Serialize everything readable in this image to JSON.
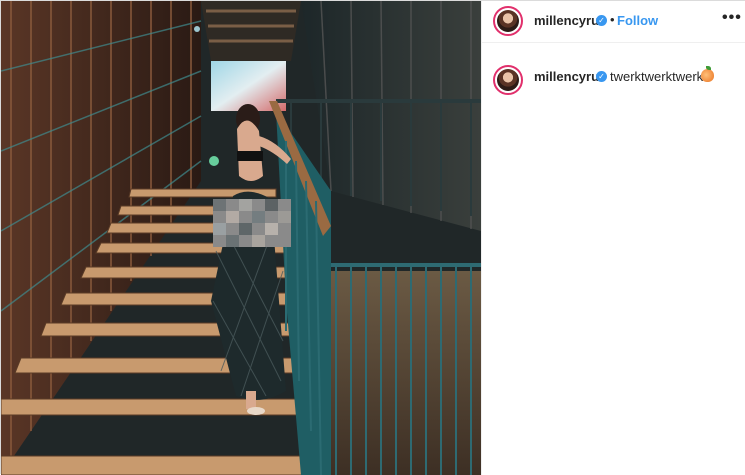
{
  "post": {
    "username": "millencyrus",
    "separator": "•",
    "follow_label": "Follow",
    "more_label": "•••",
    "caption_text": "twerktwerktwerk",
    "caption_emoji": "peach-emoji",
    "verified_glyph": "✓"
  },
  "icons": {
    "verified": "verified-badge-icon",
    "more": "more-options-icon"
  },
  "colors": {
    "link_blue": "#3897f0",
    "text_dark": "#262626",
    "story_ring": "#e1306c",
    "border": "#dbdbdb"
  }
}
